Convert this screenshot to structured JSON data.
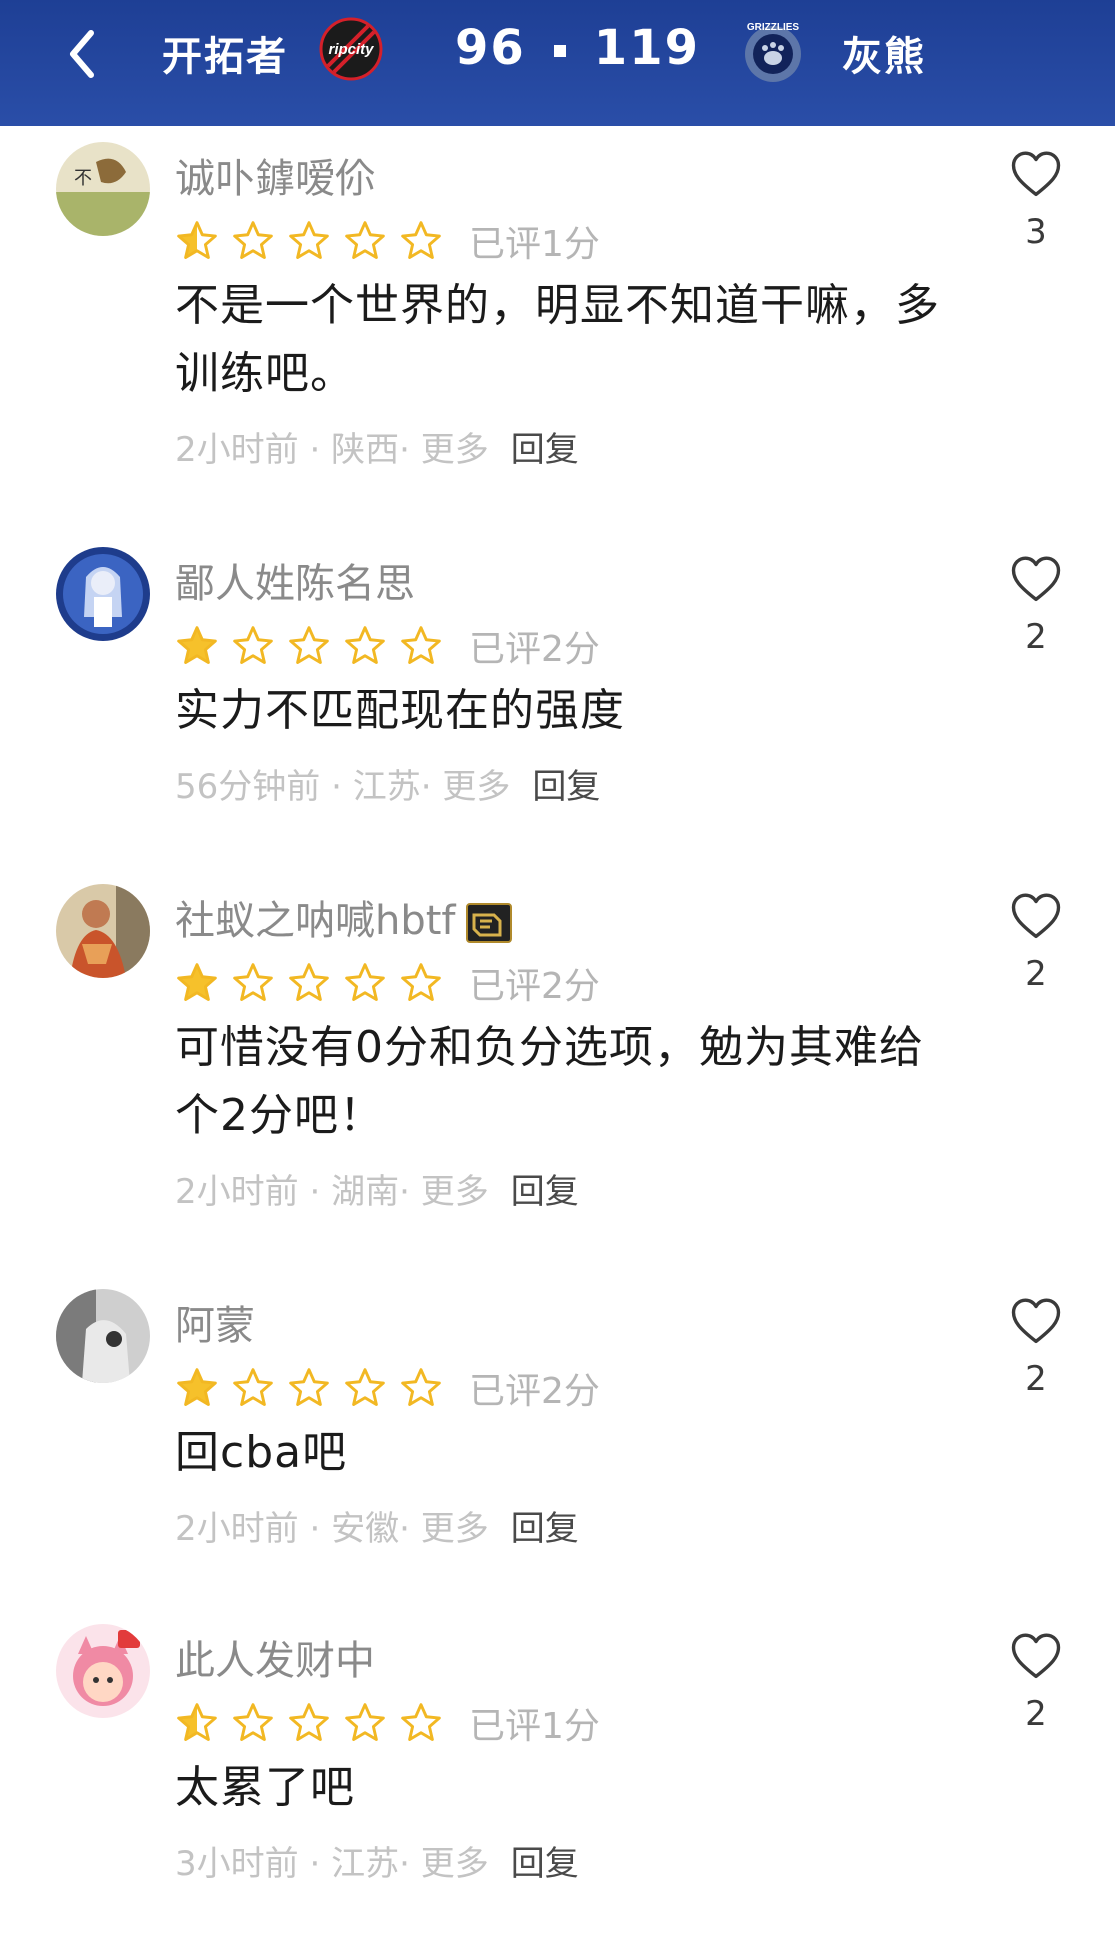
{
  "header": {
    "home_team": "开拓者",
    "home_logo_text": "ripcity",
    "home_score": "96",
    "away_score": "119",
    "away_logo_text": "GRIZZLIES",
    "away_team": "灰熊",
    "bg_color": "#1e3f95"
  },
  "comments": [
    {
      "username": "诚卟鎼嗳伱",
      "rating": 1,
      "half_star": true,
      "rating_label": "已评1分",
      "text": "不是一个世界的，明显不知道干嘛，多训练吧。",
      "time": "2小时前",
      "location": "陕西",
      "more": "更多",
      "reply": "回复",
      "likes": "3"
    },
    {
      "username": "鄙人姓陈名思",
      "rating": 1,
      "half_star": false,
      "rating_label": "已评2分",
      "text": "实力不匹配现在的强度",
      "time": "56分钟前",
      "location": "江苏",
      "more": "更多",
      "reply": "回复",
      "likes": "2"
    },
    {
      "username": "社蚁之呐喊hbtf",
      "rating": 1,
      "half_star": false,
      "rating_label": "已评2分",
      "text": "可惜没有0分和负分选项，勉为其难给个2分吧！",
      "time": "2小时前",
      "location": "湖南",
      "more": "更多",
      "reply": "回复",
      "likes": "2"
    },
    {
      "username": "阿蒙",
      "rating": 1,
      "half_star": false,
      "rating_label": "已评2分",
      "text": "回cba吧",
      "time": "2小时前",
      "location": "安徽",
      "more": "更多",
      "reply": "回复",
      "likes": "2"
    },
    {
      "username": "此人发财中",
      "rating": 1,
      "half_star": true,
      "rating_label": "已评1分",
      "text": "太累了吧",
      "time": "3小时前",
      "location": "江苏",
      "more": "更多",
      "reply": "回复",
      "likes": "2"
    }
  ],
  "colors": {
    "star_fill": "#f6c12b",
    "star_outline": "#f2b823",
    "muted": "#b5b5b5"
  }
}
